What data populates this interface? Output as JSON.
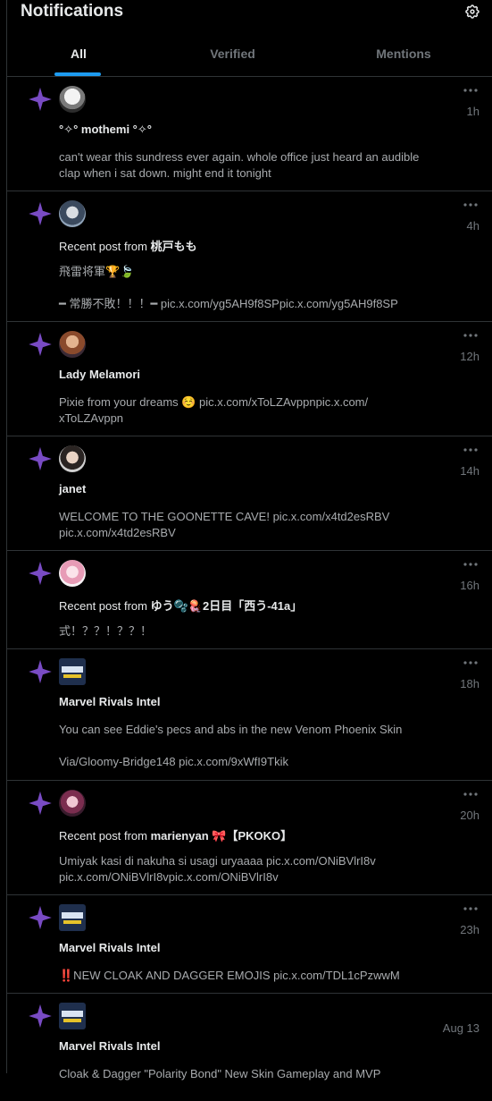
{
  "header": {
    "title": "Notifications"
  },
  "tabs": [
    {
      "label": "All",
      "active": true
    },
    {
      "label": "Verified",
      "active": false
    },
    {
      "label": "Mentions",
      "active": false
    }
  ],
  "colors": {
    "accent": "#1d9bf0",
    "star": "#794bc4",
    "background": "#000000"
  },
  "notifications": [
    {
      "time": "1h",
      "prefix": "",
      "name": "°✧° mothemi °✧°",
      "body": [
        "can't wear this sundress ever again. whole office just heard an audible clap when i sat down. might end it tonight"
      ]
    },
    {
      "time": "4h",
      "prefix": "Recent post from ",
      "name": "桃戸もも",
      "body": [
        "飛雷将軍🏆🍃",
        "━ 常勝不敗！！！━ pic.x.com/yg5AH9f8SPpic.x.com/yg5AH9f8SP"
      ]
    },
    {
      "time": "12h",
      "prefix": "",
      "name": "Lady Melamori",
      "body": [
        "Pixie from your dreams ☺️ pic.x.com/xToLZAvppnpic.x.com/ xToLZAvppn"
      ]
    },
    {
      "time": "14h",
      "prefix": "",
      "name": "janet",
      "body": [
        "WELCOME TO THE GOONETTE CAVE! pic.x.com/x4td2esRBV pic.x.com/x4td2esRBV"
      ]
    },
    {
      "time": "16h",
      "prefix": "Recent post from ",
      "name": "ゆう🫧🪼2日目「西う-41a」",
      "body": [
        "式！？？！？？！"
      ]
    },
    {
      "time": "18h",
      "prefix": "",
      "name": "Marvel Rivals Intel",
      "body": [
        "You can see Eddie's pecs and abs in the new Venom Phoenix Skin",
        "Via/Gloomy-Bridge148 pic.x.com/9xWfI9Tkik"
      ]
    },
    {
      "time": "20h",
      "prefix": "Recent post from ",
      "name": "marienyan 🎀【PKOKO】",
      "body": [
        "Umiyak kasi di nakuha si usagi uryaaaa pic.x.com/ONiBVlrI8v pic.x.com/ONiBVlrI8vpic.x.com/ONiBVlrI8v"
      ]
    },
    {
      "time": "23h",
      "prefix": "",
      "name": "Marvel Rivals Intel",
      "body": [
        "‼️NEW CLOAK AND DAGGER EMOJIS pic.x.com/TDL1cPzwwM"
      ]
    },
    {
      "time": "Aug 13",
      "prefix": "",
      "name": "Marvel Rivals Intel",
      "body": [
        "Cloak & Dagger \"Polarity Bond\" New Skin Gameplay and MVP"
      ]
    }
  ]
}
